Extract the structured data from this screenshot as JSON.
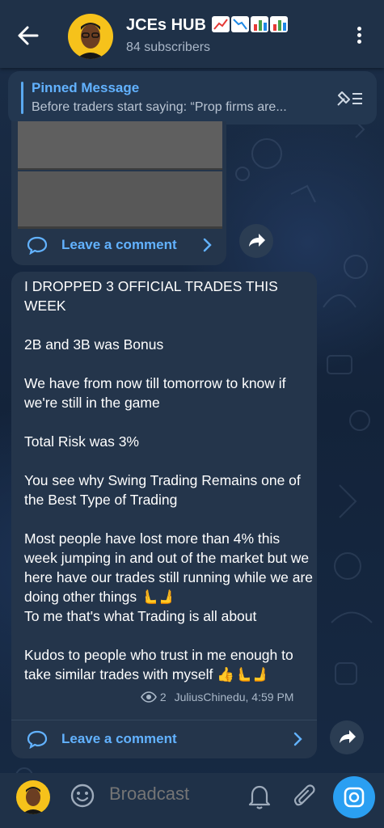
{
  "header": {
    "title": "JCEs HUB",
    "subtitle": "84 subscribers"
  },
  "pinned": {
    "label": "Pinned Message",
    "text": "Before traders start saying:  “Prop firms are..."
  },
  "post1": {
    "comment_label": "Leave a comment"
  },
  "post2": {
    "text": "I DROPPED 3 OFFICIAL TRADES THIS WEEK\n\n2B and 3B was Bonus\n\nWe have from now till tomorrow to know if we're still in the game\n\nTotal Risk was 3%\n\nYou see why Swing Trading Remains one of the Best Type of Trading\n\nMost people have lost more than 4% this week jumping in and out of the market but we here have our trades still running while we are doing other things 🫷🫸\nTo me that's what Trading is all about\n\nKudos to people who trust in me enough to take similar trades with myself 👍🫷🫸",
    "views": "2",
    "author_time": "JuliusChinedu, 4:59 PM",
    "comment_label": "Leave a comment"
  },
  "composer": {
    "placeholder": "Broadcast"
  },
  "colors": {
    "accent": "#62b2ff",
    "header_bg": "#1f3148",
    "bubble_bg": "#24354b",
    "camera_button": "#2a9ff2",
    "avatar_bg": "#f6c21b"
  },
  "icons": [
    "back-arrow-icon",
    "kebab-menu-icon",
    "unpin-icon",
    "comment-icon",
    "chevron-right-icon",
    "share-arrow-icon",
    "eye-icon",
    "emoji-icon",
    "bell-icon",
    "paperclip-icon",
    "camera-icon"
  ]
}
